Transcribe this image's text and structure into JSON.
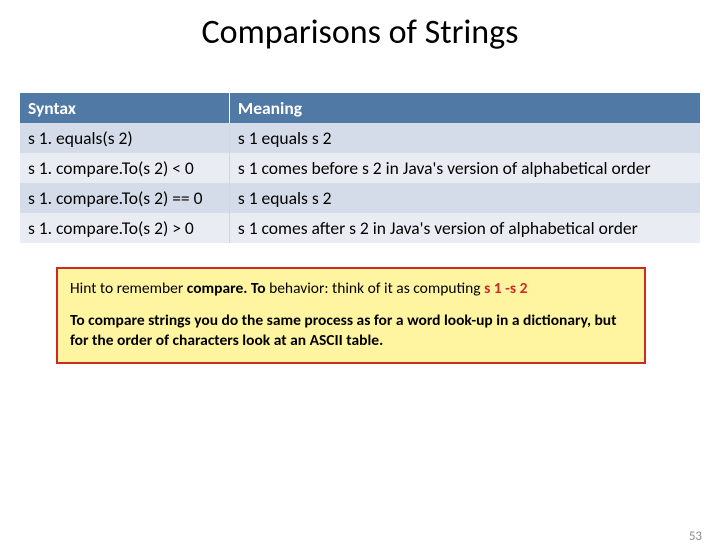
{
  "title": "Comparisons of Strings",
  "table": {
    "headers": {
      "syntax": "Syntax",
      "meaning": "Meaning"
    },
    "rows": [
      {
        "syntax": "s 1. equals(s 2)",
        "meaning": "s 1 equals s 2"
      },
      {
        "syntax": "s 1. compare.To(s 2)  <   0",
        "meaning": "s 1 comes before s 2 in Java's version of alphabetical order"
      },
      {
        "syntax": "s 1. compare.To(s 2)  == 0",
        "meaning": "s 1 equals s 2"
      },
      {
        "syntax": "s 1. compare.To(s 2)  >   0",
        "meaning": "s 1 comes after s 2 in Java's version of alphabetical order"
      }
    ]
  },
  "hint": {
    "t1a": "Hint to remember ",
    "t1b": "compare. To",
    "t1c": " behavior:  think of it as computing  ",
    "t1d": "s 1 -s 2",
    "t2": "To compare strings you do the same process as for a word look-up in a dictionary, but for the order of characters look at an ASCII table."
  },
  "page_number": "53"
}
